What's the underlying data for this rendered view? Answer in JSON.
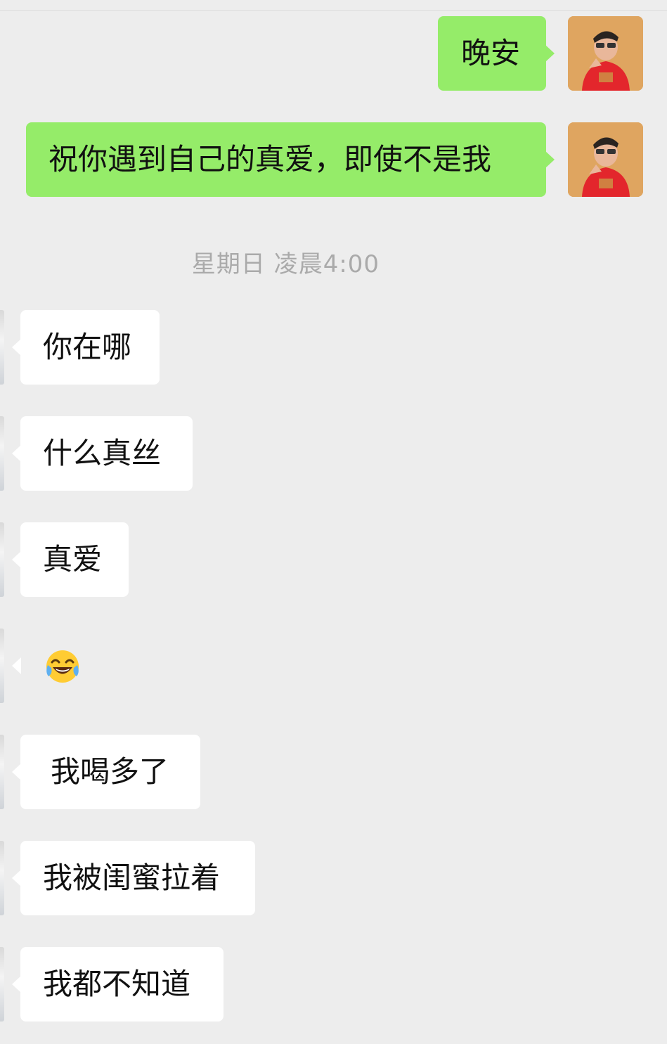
{
  "chat": {
    "outgoing": [
      {
        "text": "晚安"
      },
      {
        "text": "祝你遇到自己的真爱，即使不是我"
      }
    ],
    "timestamp": "星期日 凌晨4:00",
    "incoming": [
      {
        "text": "你在哪"
      },
      {
        "text": "什么真丝"
      },
      {
        "text": "真爱"
      },
      {
        "text": "",
        "icon": "tears-of-joy-emoji"
      },
      {
        "text": "我喝多了"
      },
      {
        "text": "我被闺蜜拉着"
      },
      {
        "text": "我都不知道"
      }
    ]
  },
  "colors": {
    "background": "#ededed",
    "outgoing_bubble": "#95ec69",
    "incoming_bubble": "#ffffff",
    "timestamp_text": "#aaaaaa"
  },
  "icons": {
    "self_avatar": "avatar-man-red-shirt",
    "other_avatar": "avatar-partial-hidden"
  }
}
